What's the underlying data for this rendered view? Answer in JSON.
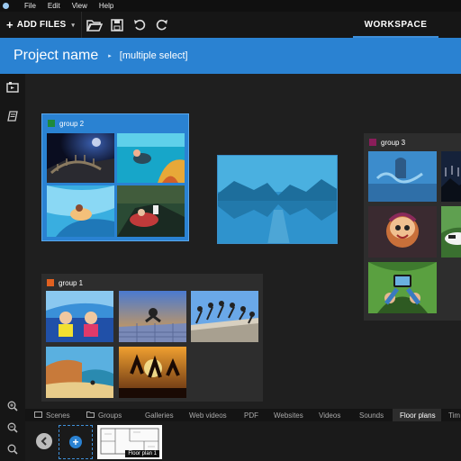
{
  "menubar": {
    "items": [
      "File",
      "Edit",
      "View",
      "Help"
    ]
  },
  "toolbar": {
    "add_files_label": "ADD FILES",
    "workspace_label": "WORKSPACE",
    "icons": [
      "folder-open-icon",
      "save-icon",
      "undo-icon",
      "redo-icon"
    ]
  },
  "project": {
    "name": "Project name",
    "selection": "[multiple select]"
  },
  "groups": [
    {
      "name": "group 2",
      "color": "#1e8a3c",
      "selected": true
    },
    {
      "name": "group 3",
      "color": "#8a1d5a",
      "selected": false
    },
    {
      "name": "group 1",
      "color": "#e06020",
      "selected": false
    }
  ],
  "bottom_tabs": [
    "Scenes",
    "Groups",
    "Galleries",
    "Web videos",
    "PDF",
    "Websites",
    "Videos",
    "Sounds",
    "Floor plans",
    "Tim"
  ],
  "active_tab": "Floor plans",
  "tray": {
    "floor_plan_label": "Floor plan 1"
  },
  "colors": {
    "accent": "#2a82d2",
    "background": "#1c1c1c"
  }
}
